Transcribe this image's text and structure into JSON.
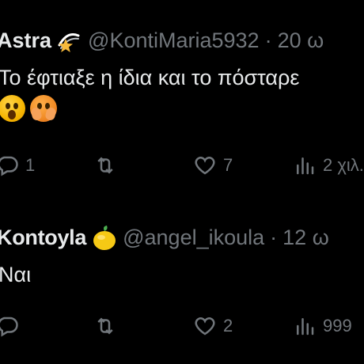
{
  "tweets": [
    {
      "display_name": "Astra",
      "name_emoji": "shooting-star-emoji",
      "handle": "@KontiMaria5932",
      "separator": "·",
      "time": "20 ω",
      "text": "Το έφτιαξε η ίδια και το πόσταρε",
      "emojis": [
        "astonished-face-emoji",
        "face-with-hand-over-mouth-emoji"
      ],
      "actions": {
        "reply_count": "1",
        "retweet_count": "",
        "like_count": "7",
        "views_count": "2 χιλ."
      }
    },
    {
      "display_name": "Kontoyla",
      "name_emoji": "lemon-emoji",
      "handle": "@angel_ikoula",
      "separator": "·",
      "time": "12 ω",
      "text": "Ναι",
      "emojis": [],
      "actions": {
        "reply_count": "",
        "retweet_count": "",
        "like_count": "2",
        "views_count": "999"
      }
    }
  ]
}
